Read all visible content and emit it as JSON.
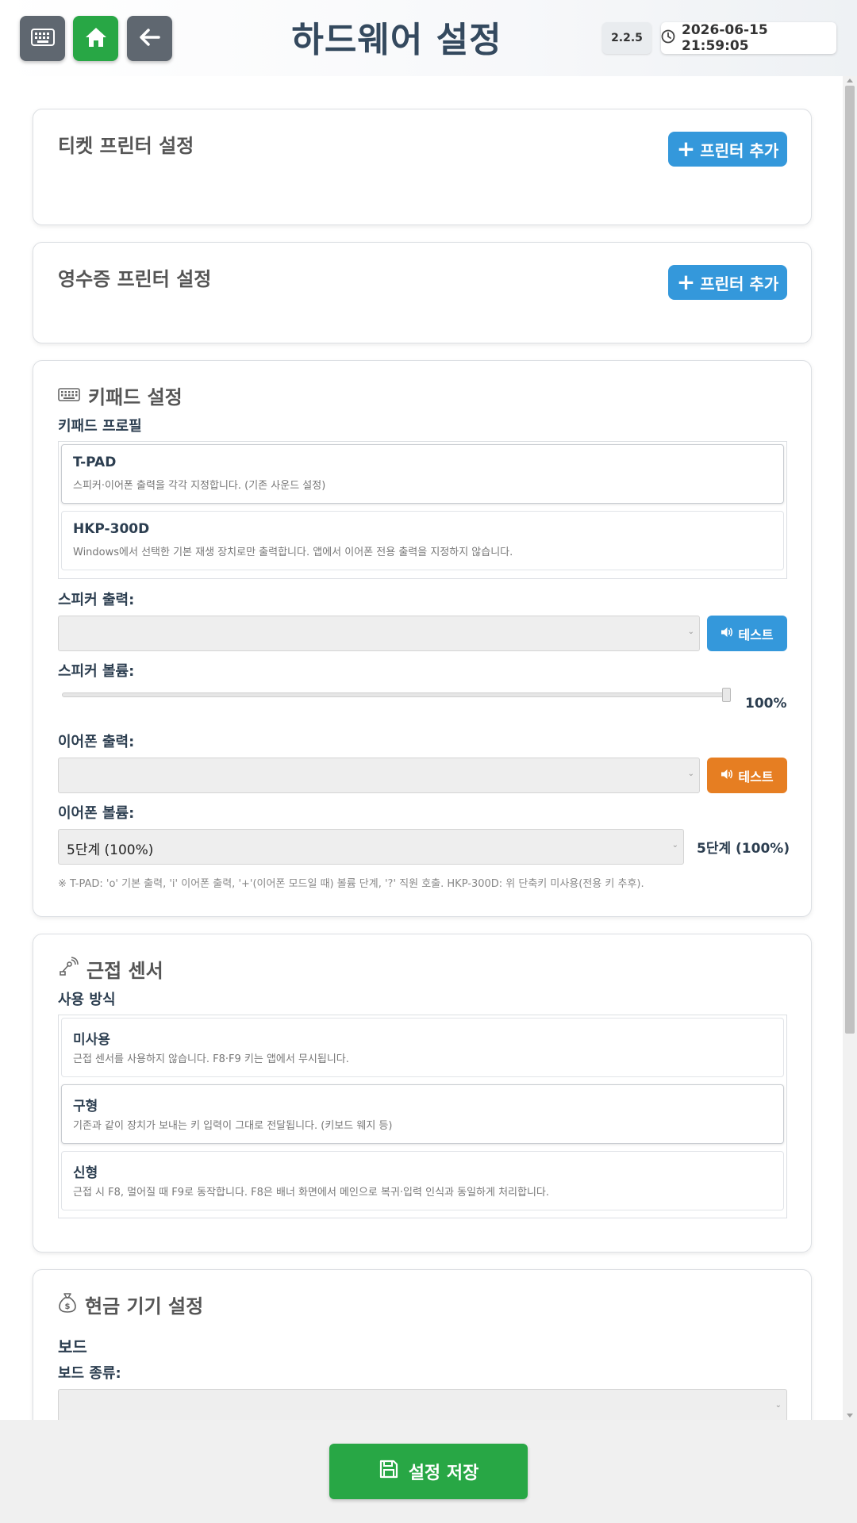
{
  "header": {
    "title": "하드웨어 설정",
    "version": "2.2.5",
    "datetime": "2026-06-15 21:59:05",
    "buttons": [
      {
        "icon": "keyboard-icon"
      },
      {
        "icon": "home-icon"
      },
      {
        "icon": "back-arrow-icon"
      }
    ]
  },
  "ticket_printer": {
    "title": "티켓 프린터 설정",
    "add_label": "프린터 추가"
  },
  "receipt_printer": {
    "title": "영수증 프린터 설정",
    "add_label": "프린터 추가"
  },
  "keypad": {
    "title": "키패드 설정",
    "profile_label": "키패드 프로필",
    "profiles": [
      {
        "name": "T-PAD",
        "desc": "스피커·이어폰 출력을 각각 지정합니다. (기존 사운드 설정)"
      },
      {
        "name": "HKP-300D",
        "desc": "Windows에서 선택한 기본 재생 장치로만 출력합니다. 앱에서 이어폰 전용 출력을 지정하지 않습니다."
      }
    ],
    "selected_profile": "T-PAD",
    "speaker_output_label": "스피커 출력:",
    "speaker_output_value": "",
    "speaker_test_label": "테스트",
    "speaker_volume_label": "스피커 볼륨:",
    "speaker_volume_value": "100%",
    "speaker_volume_level": 1.0,
    "earphone_output_label": "이어폰 출력:",
    "earphone_output_value": "",
    "earphone_test_label": "테스트",
    "earphone_volume_label": "이어폰 볼륨:",
    "earphone_volume_selected": "5단계 (100%)",
    "earphone_volume_display": "5단계 (100%)",
    "note": "※ T-PAD: 'o' 기본 출력, 'i' 이어폰 출력, '+'(이어폰 모드일 때) 볼륨 단계, '?' 직원 호출. HKP-300D: 위 단축키 미사용(전용 키 추후)."
  },
  "proximity": {
    "title": "근접 센서",
    "mode_label": "사용 방식",
    "modes": [
      {
        "name": "미사용",
        "desc": "근접 센서를 사용하지 않습니다. F8·F9 키는 앱에서 무시됩니다."
      },
      {
        "name": "구형",
        "desc": "기존과 같이 장치가 보내는 키 입력이 그대로 전달됩니다. (키보드 웨지 등)"
      },
      {
        "name": "신형",
        "desc": "근접 시 F8, 멀어질 때 F9로 동작합니다. F8은 배너 화면에서 메인으로 복귀·입력 인식과 동일하게 처리합니다."
      }
    ],
    "selected_mode": "구형"
  },
  "cash": {
    "title": "현금 기기 설정",
    "board_label": "보드",
    "board_type_label": "보드 종류:"
  },
  "footer": {
    "save_label": "설정 저장"
  },
  "colors": {
    "accent_blue": "#3498db",
    "accent_green": "#28a745",
    "accent_orange": "#e67e22",
    "title_text": "#34495e"
  }
}
